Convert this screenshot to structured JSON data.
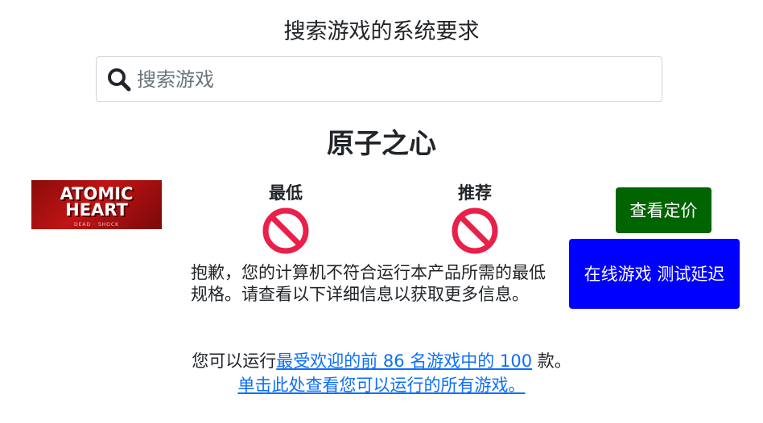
{
  "page_title": "搜索游戏的系统要求",
  "search": {
    "placeholder": "搜索游戏",
    "value": ""
  },
  "game": {
    "title": "原子之心",
    "logo_text": "ATOMIC HEART",
    "logo_subtext": "DEAD · SHOCK"
  },
  "requirements": {
    "minimum_label": "最低",
    "recommended_label": "推荐",
    "minimum_status_icon": "prohibited-icon",
    "recommended_status_icon": "prohibited-icon",
    "status_color": "#e8204a"
  },
  "sorry_message": "抱歉，您的计算机不符合运行本产品所需的最低规格。请查看以下详细信息以获取更多信息。",
  "buttons": {
    "price_label": "查看定价",
    "latency_label": "在线游戏 测试延迟",
    "price_color": "#006400",
    "latency_color": "#0000ff"
  },
  "run_info": {
    "prefix": "您可以运行",
    "link_text": "最受欢迎的前 86 名游戏中的 100",
    "suffix": " 款。",
    "all_games_link": "单击此处查看您可以运行的所有游戏。"
  }
}
